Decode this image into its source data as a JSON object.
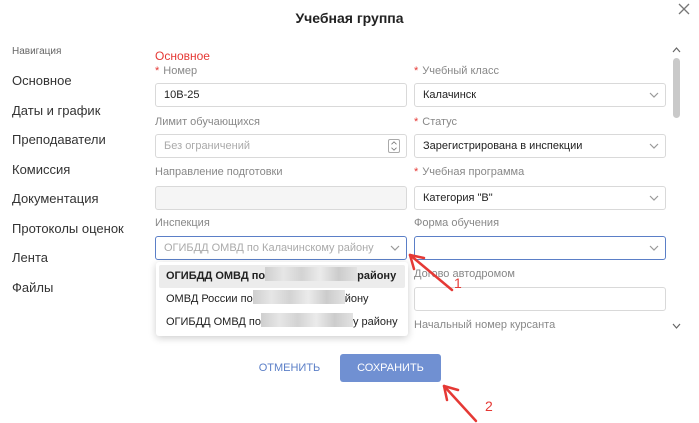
{
  "modal": {
    "title": "Учебная группа"
  },
  "nav": {
    "heading": "Навигация",
    "items": [
      "Основное",
      "Даты и график",
      "Преподаватели",
      "Комиссия",
      "Документация",
      "Протоколы оценок",
      "Лента",
      "Файлы"
    ]
  },
  "form": {
    "section_title": "Основное",
    "number": {
      "label": "Номер",
      "value": "10В-25"
    },
    "class": {
      "label": "Учебный класс",
      "value": "Калачинск"
    },
    "limit": {
      "label": "Лимит обучающихся",
      "placeholder": "Без ограничений"
    },
    "status": {
      "label": "Статус",
      "value": "Зарегистрирована в инспекции"
    },
    "direction": {
      "label": "Направление подготовки",
      "value": ""
    },
    "program": {
      "label": "Учебная программа",
      "value": "Категория \"В\""
    },
    "inspection": {
      "label": "Инспекция",
      "placeholder": "ОГИБДД ОМВД по Калачинскому району"
    },
    "form_of_study": {
      "label": "Форма обучения",
      "value": ""
    },
    "autodrome": {
      "label": "Договор с автодромом",
      "visible": "Догово      автодромом",
      "value": ""
    },
    "start_number": {
      "label": "Начальный номер курсанта"
    }
  },
  "dropdown": {
    "options": [
      {
        "prefix": "ОГИБДД ОМВД по",
        "suffix": "району",
        "active": true
      },
      {
        "prefix": "ОМВД России по",
        "suffix": "йону",
        "active": false
      },
      {
        "prefix": "ОГИБДД ОМВД по",
        "suffix": "у району",
        "active": false
      }
    ]
  },
  "buttons": {
    "cancel": "ОТМЕНИТЬ",
    "save": "СОХРАНИТЬ"
  },
  "annotations": {
    "one": "1",
    "two": "2"
  },
  "colors": {
    "accent": "#7090d2",
    "link": "#5b7fc7",
    "required": "#e53935",
    "annotation": "#e53935"
  }
}
